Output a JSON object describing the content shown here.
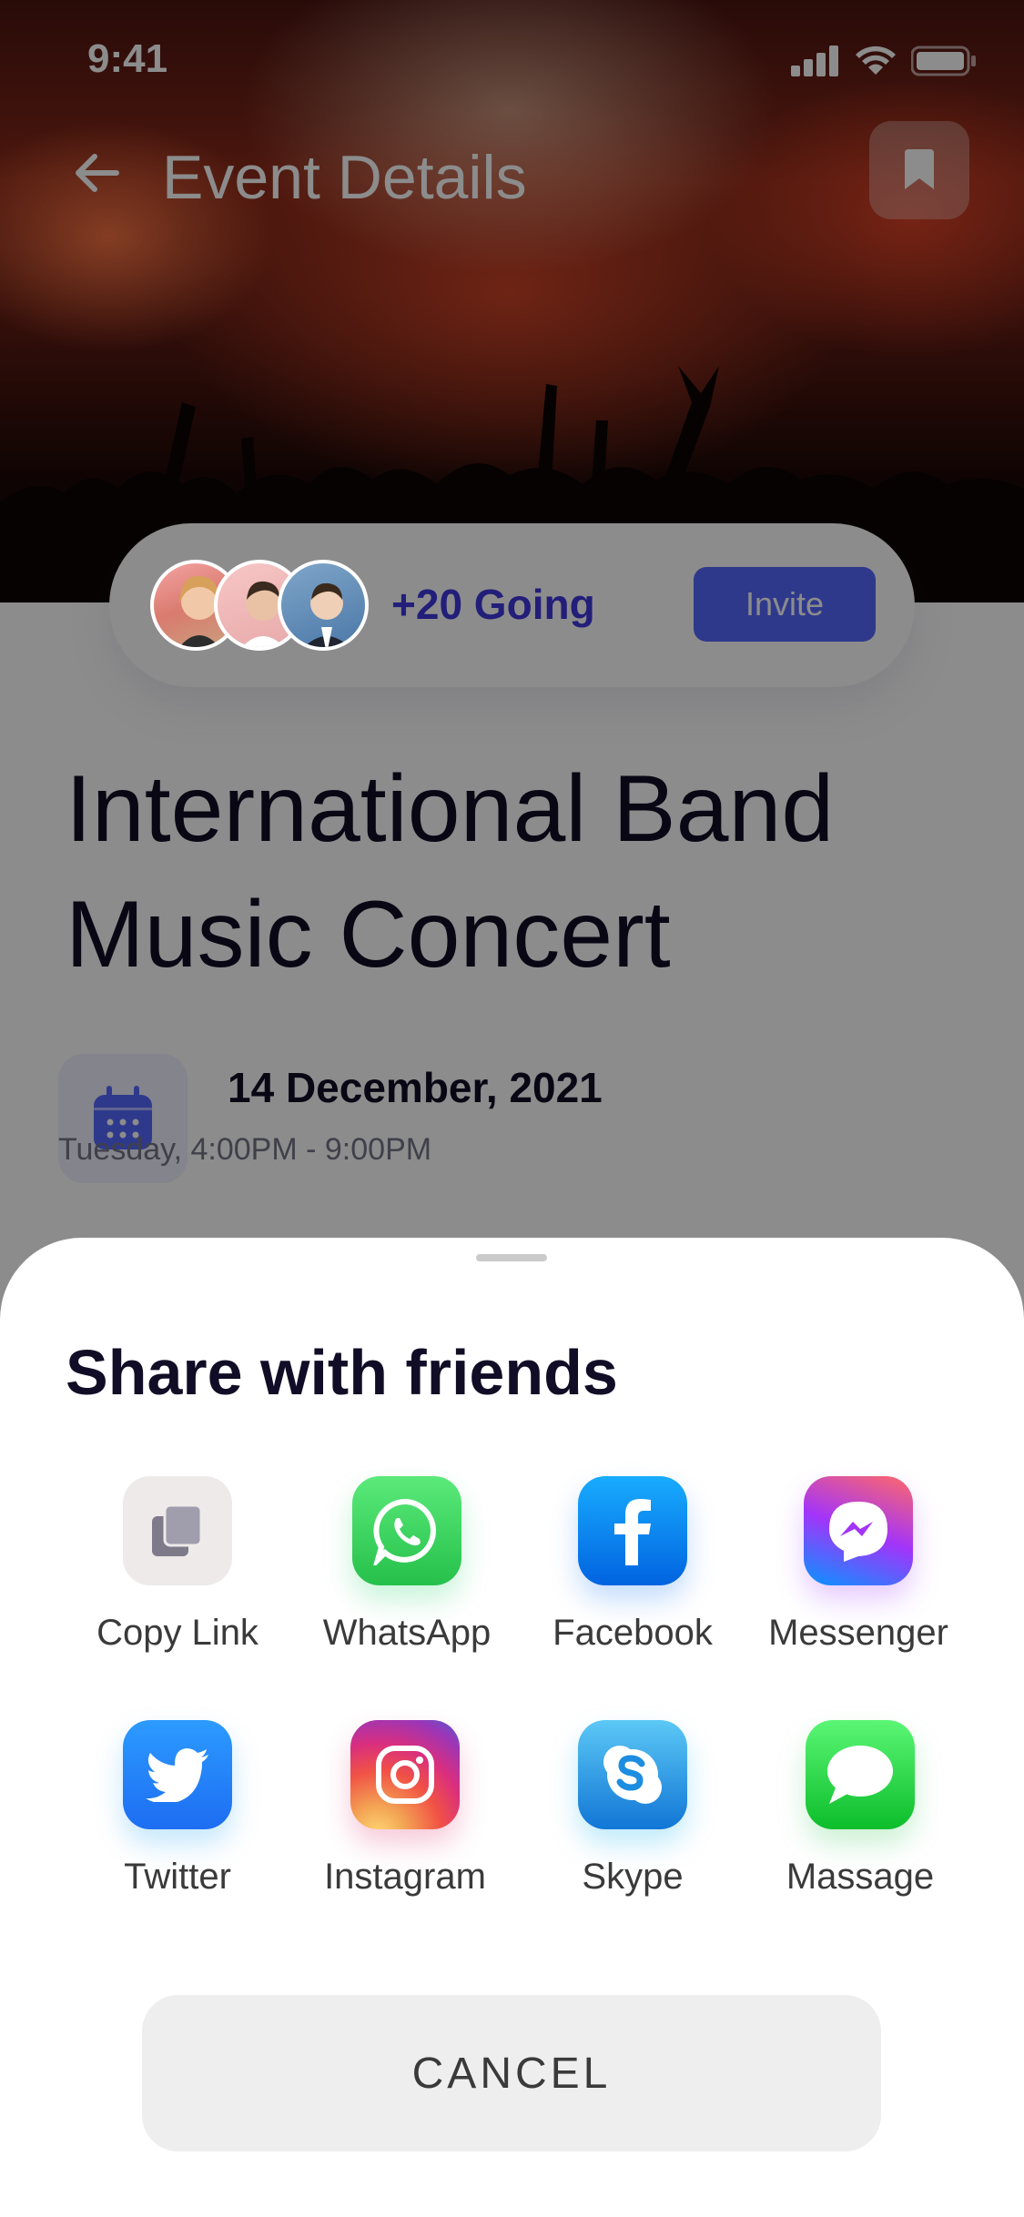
{
  "status_bar": {
    "time": "9:41"
  },
  "nav": {
    "title": "Event Details"
  },
  "going": {
    "text": "+20 Going",
    "invite_label": "Invite"
  },
  "event": {
    "title": "International Band Music Concert",
    "date": "14 December, 2021",
    "time": "Tuesday, 4:00PM - 9:00PM"
  },
  "share_sheet": {
    "title": "Share with friends",
    "items": [
      {
        "label": "Copy Link",
        "icon": "copy-link-icon",
        "color": "#EDEAE9"
      },
      {
        "label": "WhatsApp",
        "icon": "whatsapp-icon",
        "color": "#25D366"
      },
      {
        "label": "Facebook",
        "icon": "facebook-icon",
        "color": "#1877F2"
      },
      {
        "label": "Messenger",
        "icon": "messenger-icon",
        "color": "#A033FF"
      },
      {
        "label": "Twitter",
        "icon": "twitter-icon",
        "color": "#1DA1F2"
      },
      {
        "label": "Instagram",
        "icon": "instagram-icon",
        "color": "#E1306C"
      },
      {
        "label": "Skype",
        "icon": "skype-icon",
        "color": "#00AFF0"
      },
      {
        "label": "Massage",
        "icon": "message-icon",
        "color": "#34C759"
      }
    ],
    "cancel_label": "CANCEL"
  },
  "colors": {
    "accent": "#5669FF",
    "going_text": "#3F38DD",
    "dark_text": "#120D26"
  }
}
